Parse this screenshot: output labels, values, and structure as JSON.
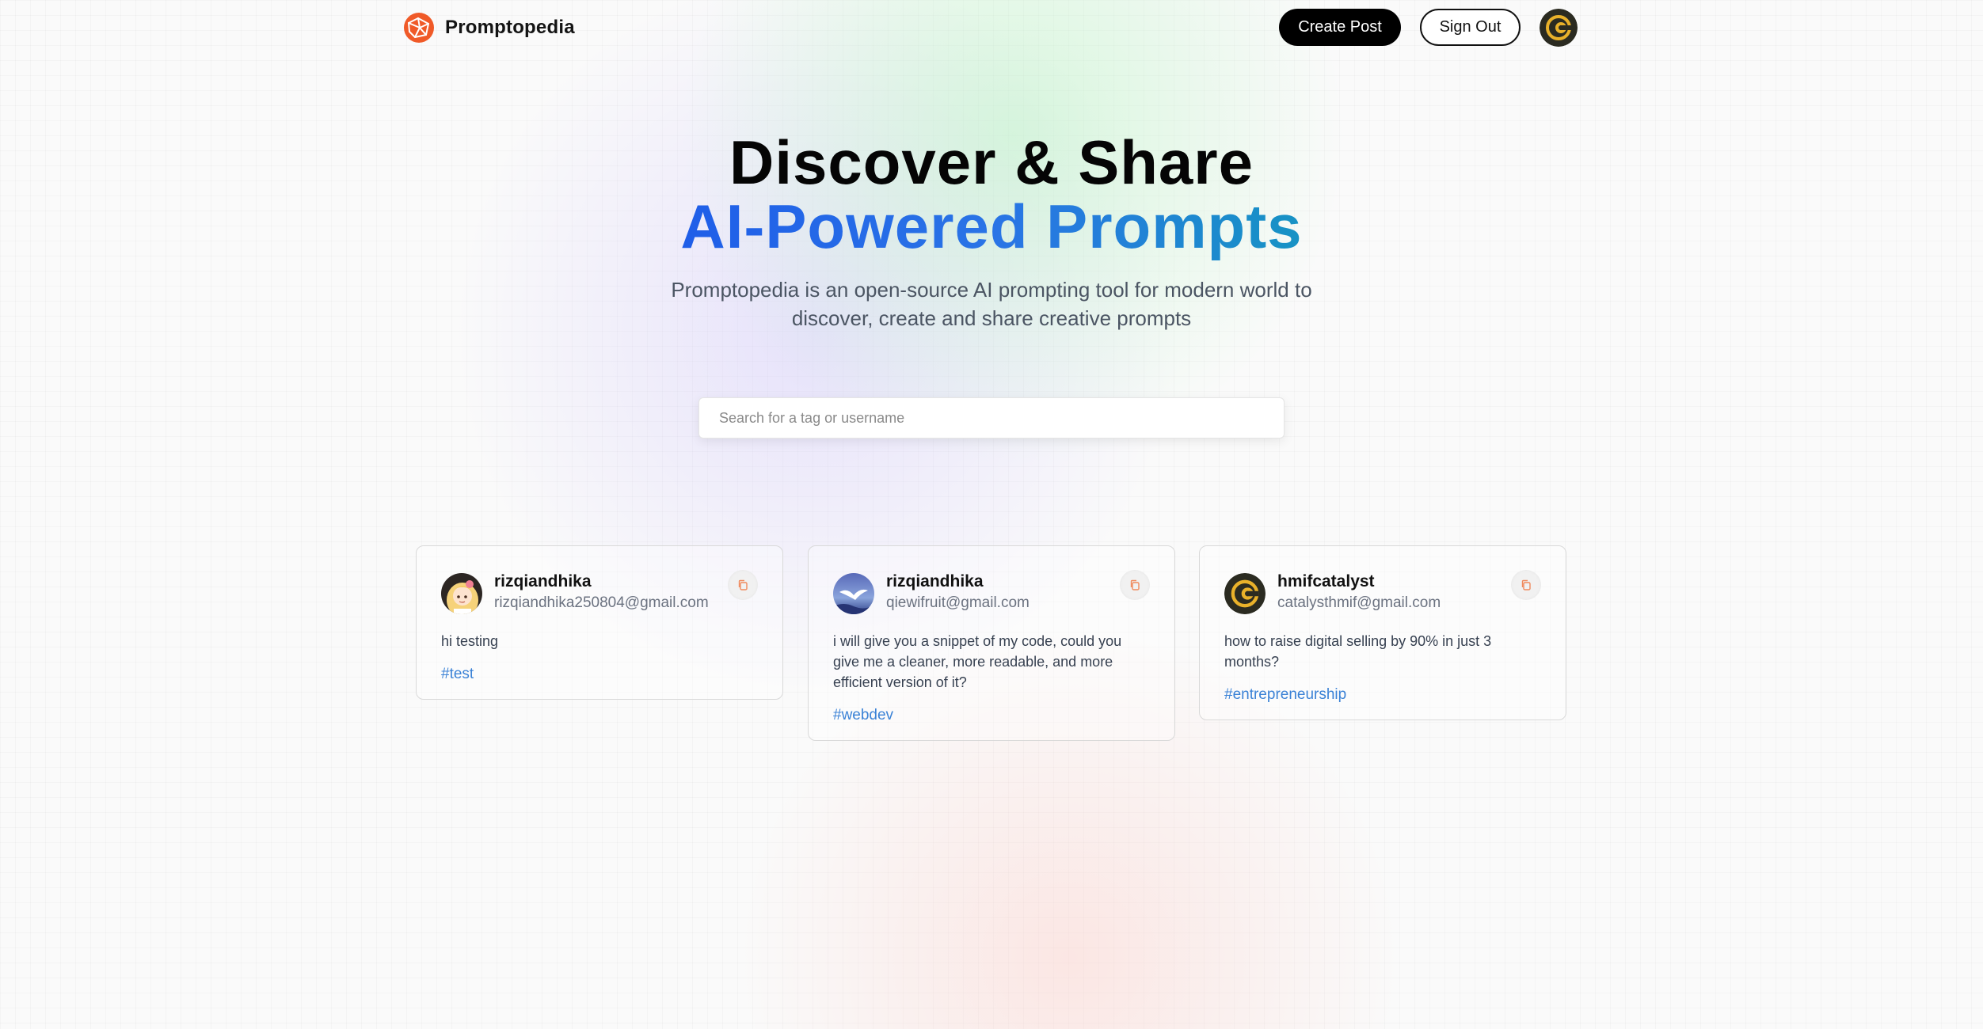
{
  "app": {
    "name": "Promptopedia",
    "accent_orange": "#f05a28",
    "accent_blue": "#1f5ee8"
  },
  "nav": {
    "logo_icon": "promptopedia-logo-icon",
    "create_label": "Create Post",
    "signout_label": "Sign Out",
    "profile_icon": "catalyst-avatar"
  },
  "hero": {
    "title_line1": "Discover & Share",
    "title_line2": "AI-Powered Prompts",
    "description": "Promptopedia is an open-source AI prompting tool for modern world to discover, create and share creative prompts"
  },
  "search": {
    "placeholder": "Search for a tag or username",
    "value": ""
  },
  "posts": [
    {
      "username": "rizqiandhika",
      "email": "rizqiandhika250804@gmail.com",
      "prompt": "hi testing",
      "tag": "#test",
      "avatar_icon": "anime-girl-avatar"
    },
    {
      "username": "rizqiandhika",
      "email": "qiewifruit@gmail.com",
      "prompt": "i will give you a snippet of my code, could you give me a cleaner, more readable, and more efficient version of it?",
      "tag": "#webdev",
      "avatar_icon": "bird-sky-avatar"
    },
    {
      "username": "hmifcatalyst",
      "email": "catalysthmif@gmail.com",
      "prompt": "how to raise digital selling by 90% in just 3 months?",
      "tag": "#entrepreneurship",
      "avatar_icon": "catalyst-logo-avatar"
    }
  ]
}
